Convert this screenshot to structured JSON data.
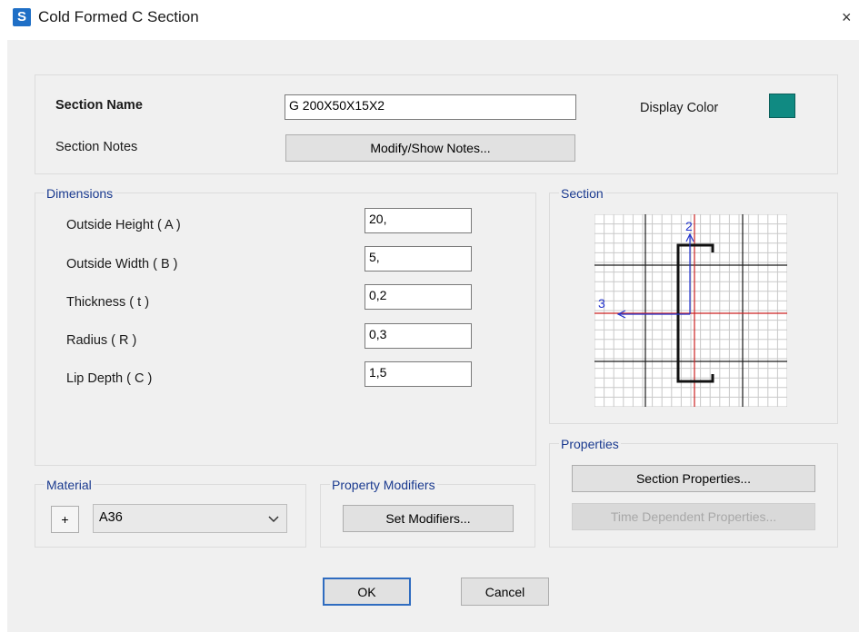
{
  "window": {
    "icon_letter": "S",
    "title": "Cold Formed C Section",
    "close_glyph": "×"
  },
  "header": {
    "section_name_label": "Section Name",
    "section_name_value": "G 200X50X15X2",
    "section_notes_label": "Section Notes",
    "modify_notes_button": "Modify/Show Notes...",
    "display_color_label": "Display Color",
    "display_color": "#108a82"
  },
  "dimensions": {
    "title": "Dimensions",
    "fields": [
      {
        "label": "Outside Height  ( A )",
        "value": "20,"
      },
      {
        "label": "Outside Width  ( B )",
        "value": "5,"
      },
      {
        "label": "Thickness  ( t )",
        "value": "0,2"
      },
      {
        "label": "Radius  ( R )",
        "value": "0,3"
      },
      {
        "label": "Lip Depth  ( C )",
        "value": "1,5"
      }
    ]
  },
  "section": {
    "title": "Section",
    "axis_2_label": "2",
    "axis_3_label": "3"
  },
  "properties": {
    "title": "Properties",
    "section_properties_button": "Section Properties...",
    "time_dependent_button": "Time Dependent Properties..."
  },
  "material": {
    "title": "Material",
    "add_button": "+",
    "selected": "A36"
  },
  "property_modifiers": {
    "title": "Property Modifiers",
    "set_button": "Set Modifiers..."
  },
  "footer": {
    "ok_button": "OK",
    "cancel_button": "Cancel"
  },
  "colors": {
    "group_title": "#1a3a8f",
    "axis_blue": "#2233cc",
    "axis_red": "#cc2222",
    "default_button_border": "#2f6cc0"
  }
}
